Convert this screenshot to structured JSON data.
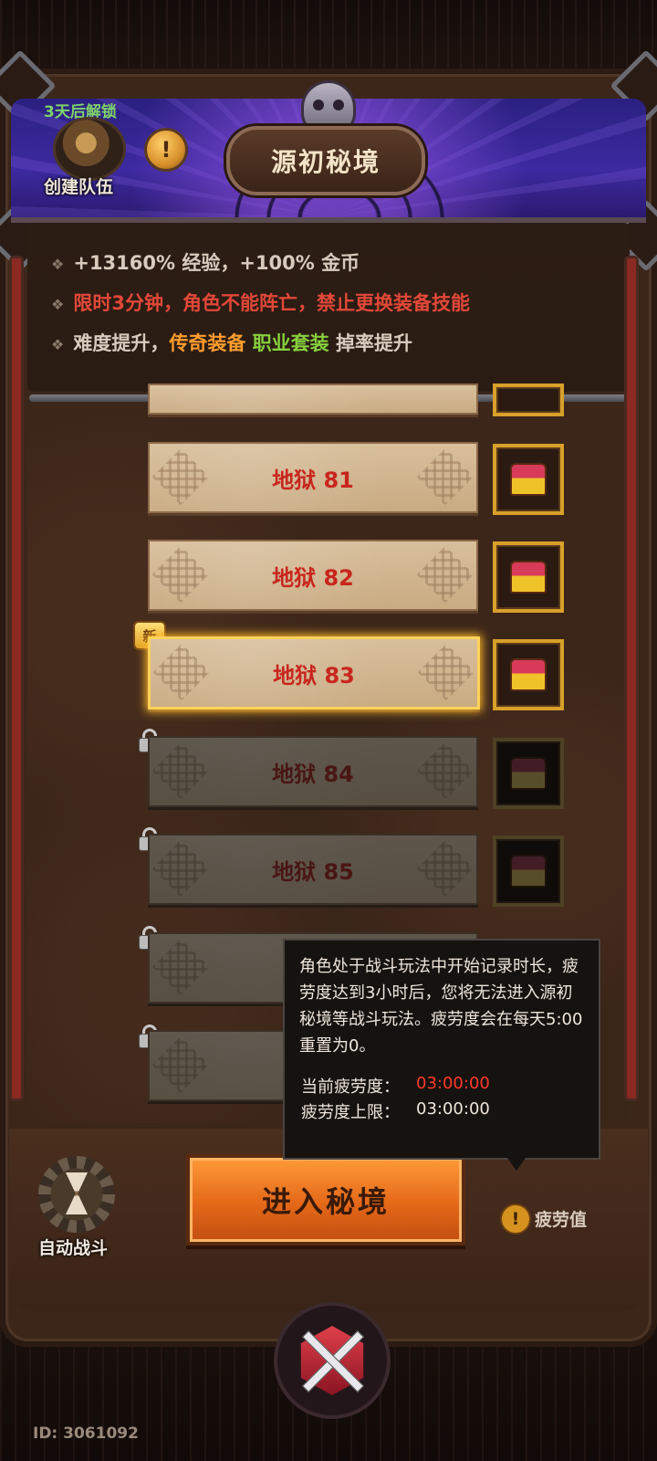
{
  "header": {
    "title": "源初秘境",
    "unlock_text": "3天后解锁",
    "team_label": "创建队伍",
    "info_glyph": "!"
  },
  "bonus_lines": {
    "line1": "+13160% 经验，+100% 金币",
    "line2": "限时3分钟，角色不能阵亡，禁止更换装备技能",
    "line3_prefix": "难度提升，",
    "line3_legend": "传奇装备",
    "line3_set": "职业套装",
    "line3_suffix": "掉率提升",
    "bullet": "❖"
  },
  "levels": [
    {
      "label": "地狱 81",
      "state": "unlocked"
    },
    {
      "label": "地狱 82",
      "state": "unlocked"
    },
    {
      "label": "地狱 83",
      "state": "selected",
      "badge": "新"
    },
    {
      "label": "地狱 84",
      "state": "locked"
    },
    {
      "label": "地狱 85",
      "state": "locked"
    },
    {
      "label": "地",
      "state": "locked"
    },
    {
      "label": "地",
      "state": "locked"
    }
  ],
  "tooltip": {
    "description": "角色处于战斗玩法中开始记录时长，疲劳度达到3小时后，您将无法进入源初秘境等战斗玩法。疲劳度会在每天5:00重置为0。",
    "current_label": "当前疲劳度：",
    "current_value": "03:00:00",
    "limit_label": "疲劳度上限：",
    "limit_value": "03:00:00"
  },
  "controls": {
    "auto_battle_label": "自动战斗",
    "enter_button_label": "进入秘境",
    "fatigue_label": "疲劳值",
    "fatigue_glyph": "!"
  },
  "footer": {
    "id_text": "ID: 3061092"
  },
  "colors": {
    "level_text": "#c8261e",
    "legend_color": "#ff9d2e",
    "set_color": "#86d03d",
    "warning_red": "#e24838"
  }
}
